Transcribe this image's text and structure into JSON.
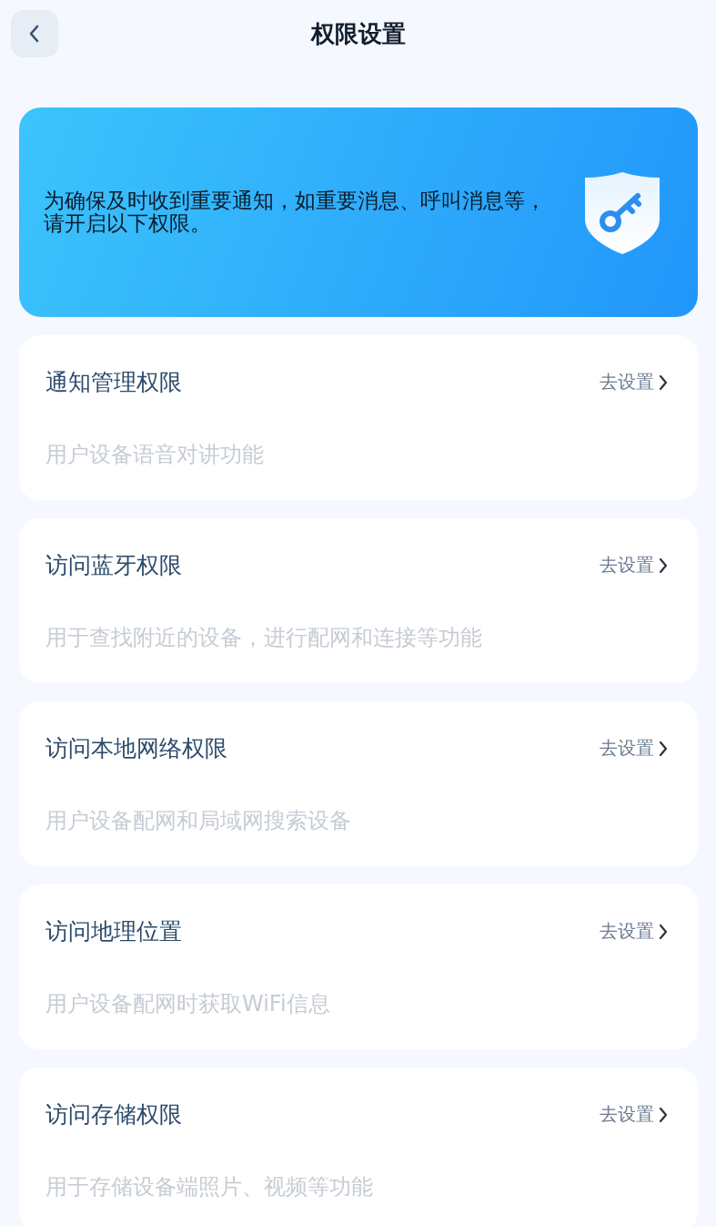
{
  "header": {
    "title": "权限设置"
  },
  "banner": {
    "text": "为确保及时收到重要通知，如重要消息、呼叫消息等，请开启以下权限。"
  },
  "permissions": [
    {
      "title": "通知管理权限",
      "action": "去设置",
      "description": "用户设备语音对讲功能"
    },
    {
      "title": "访问蓝牙权限",
      "action": "去设置",
      "description": "用于查找附近的设备，进行配网和连接等功能"
    },
    {
      "title": "访问本地网络权限",
      "action": "去设置",
      "description": "用户设备配网和局域网搜索设备"
    },
    {
      "title": "访问地理位置",
      "action": "去设置",
      "description": "用户设备配网时获取WiFi信息"
    },
    {
      "title": "访问存储权限",
      "action": "去设置",
      "description": "用于存储设备端照片、视频等功能"
    }
  ]
}
